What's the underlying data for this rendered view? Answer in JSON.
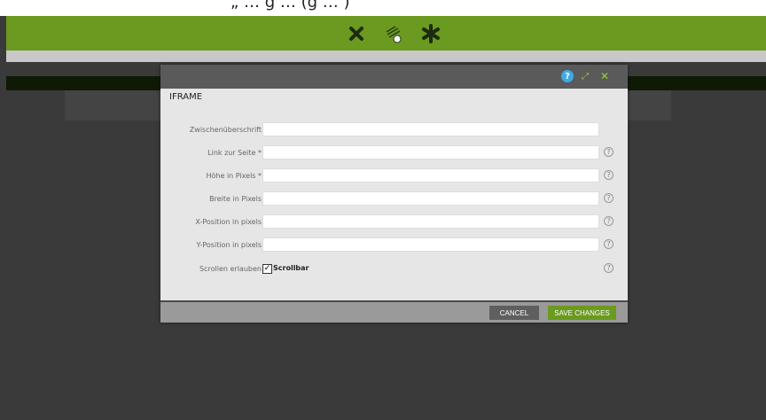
{
  "top_text": "„ … g … (g … )",
  "toolbar": {
    "icons": [
      "crossed-tools-icon",
      "magic-wand-icon",
      "asterisk-icon"
    ]
  },
  "modal": {
    "title": "IFRAME",
    "header_icons": {
      "help": "?",
      "expand": "⤢",
      "close": "✕"
    },
    "fields": [
      {
        "label": "Zwischenüberschrift",
        "value": "",
        "help": false
      },
      {
        "label": "Link zur Seite *",
        "value": "",
        "help": true
      },
      {
        "label": "Höhe in Pixels *",
        "value": "",
        "help": true
      },
      {
        "label": "Breite in Pixels",
        "value": "",
        "help": true
      },
      {
        "label": "X-Position in pixels",
        "value": "",
        "help": true
      },
      {
        "label": "Y-Position in pixels",
        "value": "",
        "help": true
      }
    ],
    "scroll": {
      "label": "Scrollen erlauben",
      "checkbox_label": "Scrollbar",
      "checked": true
    },
    "cancel_label": "CANCEL",
    "save_label": "SAVE CHANGES"
  },
  "colors": {
    "brand_green": "#6a9a1f",
    "accent_blue": "#3ea9e8"
  }
}
